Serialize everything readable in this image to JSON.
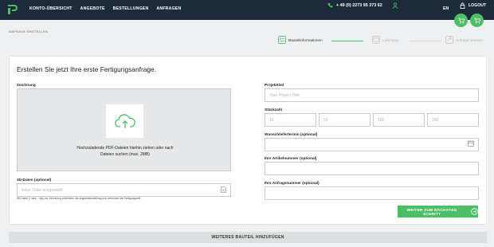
{
  "colors": {
    "navbar": "#1d2a3a",
    "accent": "#4cbf66",
    "background": "#eef0f1"
  },
  "header": {
    "nav": [
      "KONTO-ÜBERSICHT",
      "ANGEBOTE",
      "BESTELLUNGEN",
      "ANFRAGEN"
    ],
    "phone": "+ 49 (0) 2273 95 373 62",
    "language": "EN",
    "logout": "LOGOUT"
  },
  "breadcrumb": "ANFRAGE ERSTELLEN",
  "steps": [
    {
      "label": "Bauteilinformationen",
      "icon": "list-check-icon",
      "active": true
    },
    {
      "label": "Lieferung",
      "icon": "delivery-icon",
      "active": false
    },
    {
      "label": "Anfrage senden",
      "icon": "send-request-icon",
      "active": false
    }
  ],
  "form": {
    "title": "Erstellen Sie jetzt Ihre erste Fertigungsanfrage.",
    "drawing_label": "Zeichnung",
    "dropzone_text": "Hochzuladende PDF-Dateien hierhin ziehen oder nach Dateien suchen (max. 2MB)",
    "data3d_label": "3D-Daten (optional)",
    "data3d_placeholder": "keine Datei ausgewählt",
    "data3d_hint": "3D-Daten (*.step, *.stp) zur Zeichnung erleichtern die Angebotserstellung und verkürzen die Fertigungszeit.",
    "project_label": "Projekttitel",
    "project_placeholder": "Your Project Titel",
    "quantity_label": "Stückzahl",
    "quantities": [
      "10",
      "50",
      "100",
      "200"
    ],
    "deadline_label": "Wunschliefertermin (optional)",
    "article_label": "Ihre Artikelnummer (optional)",
    "request_label": "Ihre Anfragenummer (optional)",
    "next_button": "WEITER ZUM NÄCHSTEN SCHRITT"
  },
  "more_button": "WEITERES BAUTEIL HINZUFÜGEN"
}
